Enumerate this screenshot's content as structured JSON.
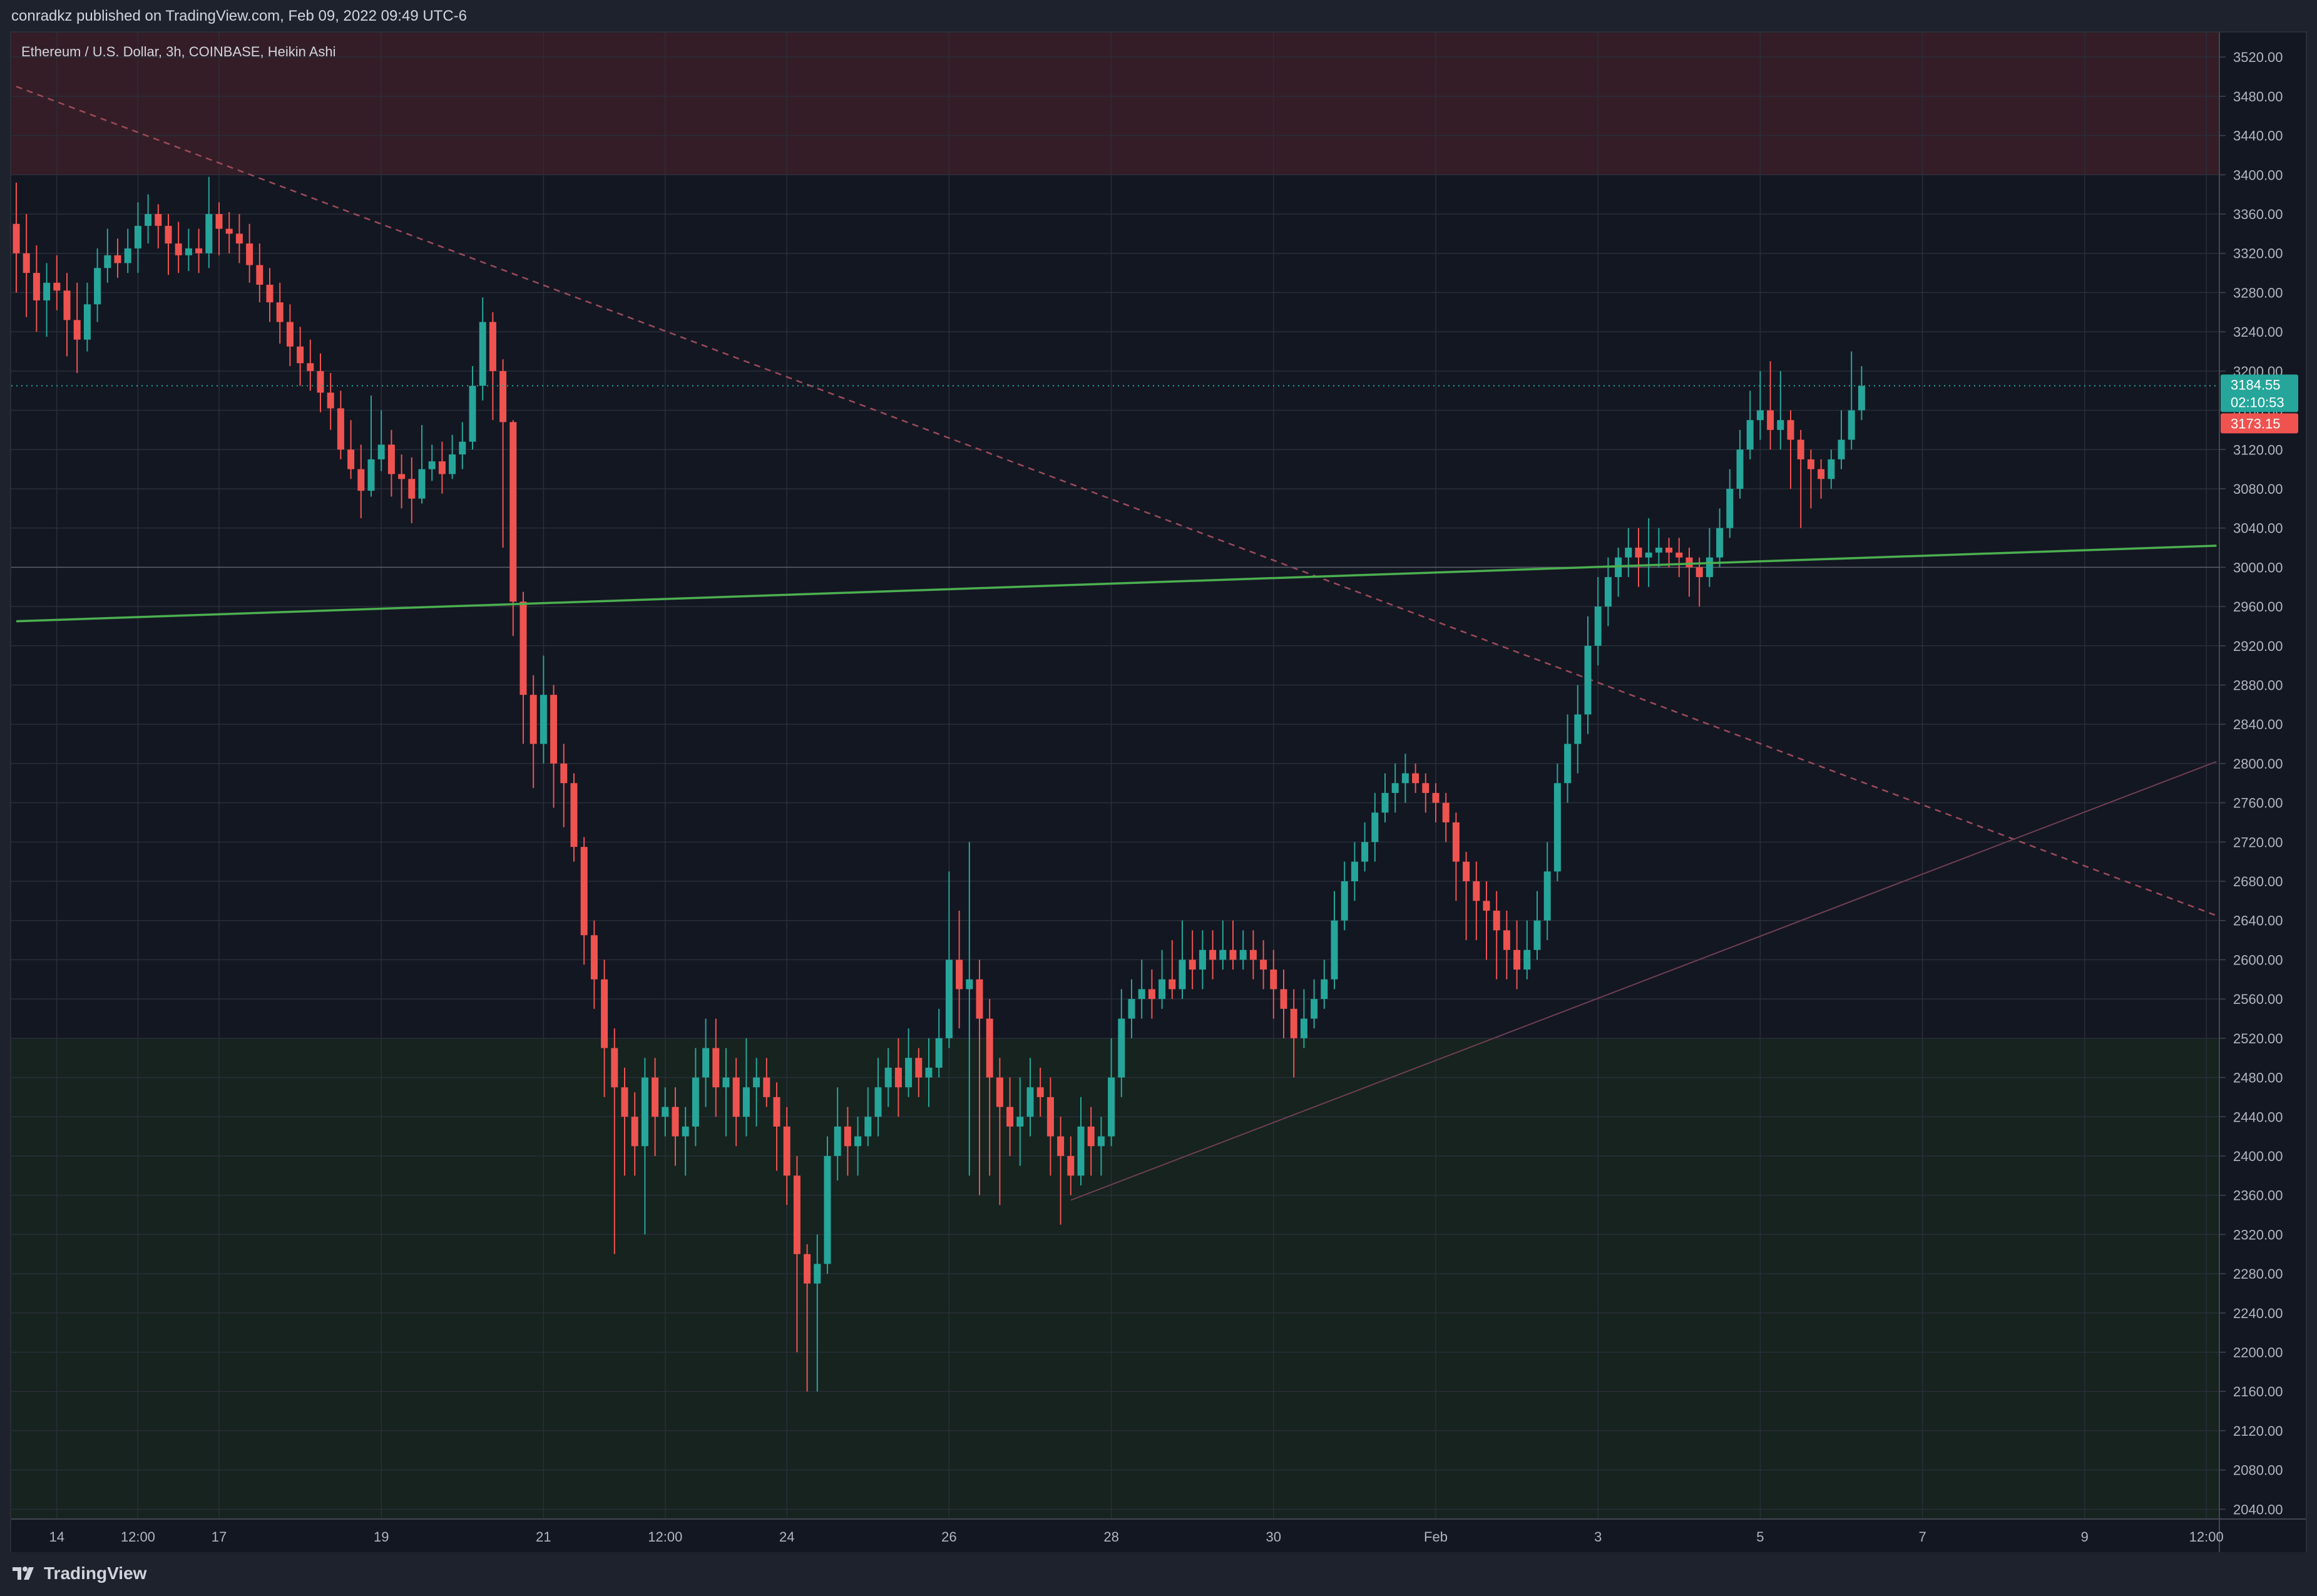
{
  "header": {
    "publisher_line": "conradkz published on TradingView.com, Feb 09, 2022 09:49 UTC-6"
  },
  "chart": {
    "symbol_line": "Ethereum / U.S. Dollar, 3h, COINBASE, Heikin Ashi",
    "last_price_label": "3184.55",
    "countdown_label": "02:10:53",
    "prev_close_label": "3173.15"
  },
  "footer": {
    "brand": "TradingView"
  },
  "colors": {
    "up": "#26a69a",
    "down": "#ef5350",
    "background": "#131722",
    "support_line": "#4caf50",
    "resistance_zone": "#3b1e27",
    "demand_zone": "#17261f"
  },
  "chart_data": {
    "type": "candlestick",
    "style": "heikin-ashi",
    "timeframe": "3h",
    "ylim": [
      2030,
      3545
    ],
    "y_ticks": [
      2040,
      2080,
      2120,
      2160,
      2200,
      2240,
      2280,
      2320,
      2360,
      2400,
      2440,
      2480,
      2520,
      2560,
      2600,
      2640,
      2680,
      2720,
      2760,
      2800,
      2840,
      2880,
      2920,
      2960,
      3000,
      3040,
      3080,
      3120,
      3160,
      3200,
      3240,
      3280,
      3320,
      3360,
      3400,
      3440,
      3480,
      3520
    ],
    "x_tick_labels": [
      {
        "i": 4,
        "label": "14"
      },
      {
        "i": 12,
        "label": "12:00"
      },
      {
        "i": 20,
        "label": "17"
      },
      {
        "i": 36,
        "label": "19"
      },
      {
        "i": 52,
        "label": "21"
      },
      {
        "i": 64,
        "label": "12:00"
      },
      {
        "i": 76,
        "label": "24"
      },
      {
        "i": 92,
        "label": "26"
      },
      {
        "i": 108,
        "label": "28"
      },
      {
        "i": 124,
        "label": "30"
      },
      {
        "i": 140,
        "label": "Feb"
      },
      {
        "i": 156,
        "label": "3"
      },
      {
        "i": 172,
        "label": "5"
      },
      {
        "i": 188,
        "label": "7"
      },
      {
        "i": 204,
        "label": "9"
      },
      {
        "i": 216,
        "label": "12:00"
      }
    ],
    "candles": [
      [
        3350,
        3320,
        3392,
        3280
      ],
      [
        3320,
        3300,
        3360,
        3255
      ],
      [
        3300,
        3272,
        3328,
        3240
      ],
      [
        3272,
        3290,
        3310,
        3235
      ],
      [
        3290,
        3282,
        3318,
        3262
      ],
      [
        3282,
        3252,
        3300,
        3215
      ],
      [
        3252,
        3232,
        3290,
        3198
      ],
      [
        3232,
        3268,
        3290,
        3220
      ],
      [
        3268,
        3305,
        3325,
        3250
      ],
      [
        3305,
        3318,
        3345,
        3290
      ],
      [
        3318,
        3310,
        3335,
        3295
      ],
      [
        3310,
        3325,
        3345,
        3300
      ],
      [
        3325,
        3348,
        3372,
        3300
      ],
      [
        3348,
        3360,
        3380,
        3330
      ],
      [
        3360,
        3348,
        3370,
        3325
      ],
      [
        3348,
        3330,
        3360,
        3298
      ],
      [
        3330,
        3318,
        3352,
        3300
      ],
      [
        3318,
        3325,
        3345,
        3302
      ],
      [
        3325,
        3320,
        3345,
        3300
      ],
      [
        3320,
        3360,
        3398,
        3305
      ],
      [
        3360,
        3345,
        3372,
        3318
      ],
      [
        3345,
        3340,
        3362,
        3320
      ],
      [
        3340,
        3330,
        3360,
        3310
      ],
      [
        3330,
        3308,
        3350,
        3290
      ],
      [
        3308,
        3288,
        3330,
        3270
      ],
      [
        3288,
        3270,
        3305,
        3250
      ],
      [
        3270,
        3250,
        3290,
        3228
      ],
      [
        3250,
        3225,
        3268,
        3205
      ],
      [
        3225,
        3208,
        3245,
        3185
      ],
      [
        3208,
        3200,
        3232,
        3180
      ],
      [
        3200,
        3178,
        3218,
        3158
      ],
      [
        3178,
        3162,
        3198,
        3140
      ],
      [
        3162,
        3120,
        3180,
        3110
      ],
      [
        3120,
        3100,
        3150,
        3090
      ],
      [
        3100,
        3078,
        3125,
        3050
      ],
      [
        3078,
        3110,
        3175,
        3072
      ],
      [
        3110,
        3125,
        3160,
        3098
      ],
      [
        3125,
        3095,
        3140,
        3072
      ],
      [
        3095,
        3090,
        3115,
        3060
      ],
      [
        3090,
        3070,
        3112,
        3045
      ],
      [
        3070,
        3100,
        3145,
        3065
      ],
      [
        3100,
        3108,
        3125,
        3088
      ],
      [
        3108,
        3095,
        3128,
        3075
      ],
      [
        3095,
        3115,
        3135,
        3090
      ],
      [
        3115,
        3128,
        3148,
        3100
      ],
      [
        3128,
        3185,
        3205,
        3120
      ],
      [
        3185,
        3250,
        3275,
        3170
      ],
      [
        3250,
        3200,
        3260,
        3150
      ],
      [
        3200,
        3148,
        3212,
        3020
      ],
      [
        3148,
        2965,
        3150,
        2930
      ],
      [
        2965,
        2870,
        2975,
        2820
      ],
      [
        2870,
        2820,
        2890,
        2775
      ],
      [
        2820,
        2870,
        2910,
        2800
      ],
      [
        2870,
        2800,
        2880,
        2755
      ],
      [
        2800,
        2780,
        2820,
        2735
      ],
      [
        2780,
        2715,
        2790,
        2700
      ],
      [
        2715,
        2625,
        2725,
        2595
      ],
      [
        2625,
        2580,
        2640,
        2550
      ],
      [
        2580,
        2510,
        2600,
        2460
      ],
      [
        2510,
        2470,
        2530,
        2300
      ],
      [
        2470,
        2440,
        2490,
        2380
      ],
      [
        2440,
        2410,
        2465,
        2380
      ],
      [
        2410,
        2480,
        2500,
        2320
      ],
      [
        2480,
        2440,
        2500,
        2400
      ],
      [
        2440,
        2450,
        2470,
        2420
      ],
      [
        2450,
        2420,
        2470,
        2390
      ],
      [
        2420,
        2430,
        2450,
        2380
      ],
      [
        2430,
        2480,
        2510,
        2410
      ],
      [
        2480,
        2510,
        2540,
        2450
      ],
      [
        2510,
        2470,
        2540,
        2440
      ],
      [
        2470,
        2480,
        2510,
        2420
      ],
      [
        2480,
        2440,
        2500,
        2410
      ],
      [
        2440,
        2470,
        2520,
        2420
      ],
      [
        2470,
        2480,
        2500,
        2430
      ],
      [
        2480,
        2460,
        2500,
        2450
      ],
      [
        2460,
        2430,
        2475,
        2385
      ],
      [
        2430,
        2380,
        2450,
        2350
      ],
      [
        2380,
        2300,
        2400,
        2200
      ],
      [
        2300,
        2270,
        2310,
        2160
      ],
      [
        2270,
        2290,
        2320,
        2160
      ],
      [
        2290,
        2400,
        2420,
        2280
      ],
      [
        2400,
        2430,
        2470,
        2375
      ],
      [
        2430,
        2410,
        2450,
        2380
      ],
      [
        2410,
        2420,
        2440,
        2380
      ],
      [
        2420,
        2440,
        2470,
        2410
      ],
      [
        2440,
        2470,
        2500,
        2420
      ],
      [
        2470,
        2490,
        2510,
        2450
      ],
      [
        2490,
        2470,
        2520,
        2440
      ],
      [
        2470,
        2500,
        2530,
        2460
      ],
      [
        2500,
        2480,
        2510,
        2460
      ],
      [
        2480,
        2490,
        2520,
        2450
      ],
      [
        2490,
        2520,
        2550,
        2480
      ],
      [
        2520,
        2600,
        2690,
        2510
      ],
      [
        2600,
        2570,
        2650,
        2530
      ],
      [
        2570,
        2580,
        2720,
        2380
      ],
      [
        2580,
        2540,
        2600,
        2360
      ],
      [
        2540,
        2480,
        2560,
        2380
      ],
      [
        2480,
        2450,
        2500,
        2350
      ],
      [
        2450,
        2430,
        2480,
        2400
      ],
      [
        2430,
        2440,
        2480,
        2390
      ],
      [
        2440,
        2470,
        2500,
        2420
      ],
      [
        2470,
        2460,
        2490,
        2440
      ],
      [
        2460,
        2420,
        2480,
        2380
      ],
      [
        2420,
        2400,
        2440,
        2330
      ],
      [
        2400,
        2380,
        2420,
        2360
      ],
      [
        2380,
        2430,
        2460,
        2370
      ],
      [
        2430,
        2410,
        2450,
        2380
      ],
      [
        2410,
        2420,
        2440,
        2380
      ],
      [
        2420,
        2480,
        2520,
        2410
      ],
      [
        2480,
        2540,
        2570,
        2460
      ],
      [
        2540,
        2560,
        2580,
        2520
      ],
      [
        2560,
        2570,
        2600,
        2540
      ],
      [
        2570,
        2560,
        2590,
        2540
      ],
      [
        2560,
        2580,
        2610,
        2550
      ],
      [
        2580,
        2570,
        2620,
        2560
      ],
      [
        2570,
        2600,
        2640,
        2560
      ],
      [
        2600,
        2590,
        2630,
        2570
      ],
      [
        2590,
        2610,
        2630,
        2570
      ],
      [
        2610,
        2600,
        2630,
        2580
      ],
      [
        2600,
        2610,
        2640,
        2590
      ],
      [
        2610,
        2600,
        2640,
        2590
      ],
      [
        2600,
        2610,
        2630,
        2590
      ],
      [
        2610,
        2600,
        2630,
        2580
      ],
      [
        2600,
        2590,
        2620,
        2570
      ],
      [
        2590,
        2570,
        2610,
        2540
      ],
      [
        2570,
        2550,
        2590,
        2520
      ],
      [
        2550,
        2520,
        2570,
        2480
      ],
      [
        2520,
        2540,
        2570,
        2510
      ],
      [
        2540,
        2560,
        2580,
        2530
      ],
      [
        2560,
        2580,
        2600,
        2550
      ],
      [
        2580,
        2640,
        2670,
        2570
      ],
      [
        2640,
        2680,
        2700,
        2630
      ],
      [
        2680,
        2700,
        2720,
        2660
      ],
      [
        2700,
        2720,
        2740,
        2690
      ],
      [
        2720,
        2750,
        2770,
        2700
      ],
      [
        2750,
        2770,
        2790,
        2740
      ],
      [
        2770,
        2780,
        2800,
        2750
      ],
      [
        2780,
        2790,
        2810,
        2760
      ],
      [
        2790,
        2780,
        2800,
        2770
      ],
      [
        2780,
        2770,
        2790,
        2750
      ],
      [
        2770,
        2760,
        2780,
        2740
      ],
      [
        2760,
        2740,
        2770,
        2720
      ],
      [
        2740,
        2700,
        2750,
        2660
      ],
      [
        2700,
        2680,
        2710,
        2620
      ],
      [
        2680,
        2660,
        2700,
        2620
      ],
      [
        2660,
        2650,
        2680,
        2600
      ],
      [
        2650,
        2630,
        2670,
        2580
      ],
      [
        2630,
        2610,
        2650,
        2580
      ],
      [
        2610,
        2590,
        2640,
        2570
      ],
      [
        2590,
        2610,
        2640,
        2580
      ],
      [
        2610,
        2640,
        2670,
        2600
      ],
      [
        2640,
        2690,
        2720,
        2620
      ],
      [
        2690,
        2780,
        2800,
        2680
      ],
      [
        2780,
        2820,
        2850,
        2760
      ],
      [
        2820,
        2850,
        2880,
        2790
      ],
      [
        2850,
        2920,
        2950,
        2830
      ],
      [
        2920,
        2960,
        2990,
        2900
      ],
      [
        2960,
        2990,
        3010,
        2940
      ],
      [
        2990,
        3010,
        3020,
        2970
      ],
      [
        3010,
        3020,
        3040,
        2990
      ],
      [
        3020,
        3010,
        3040,
        2980
      ],
      [
        3010,
        3015,
        3050,
        2980
      ],
      [
        3015,
        3020,
        3040,
        3000
      ],
      [
        3020,
        3015,
        3030,
        3000
      ],
      [
        3015,
        3010,
        3030,
        2990
      ],
      [
        3010,
        3000,
        3020,
        2970
      ],
      [
        3000,
        2990,
        3010,
        2960
      ],
      [
        2990,
        3010,
        3040,
        2980
      ],
      [
        3010,
        3040,
        3060,
        3000
      ],
      [
        3040,
        3080,
        3100,
        3030
      ],
      [
        3080,
        3120,
        3140,
        3070
      ],
      [
        3120,
        3150,
        3180,
        3110
      ],
      [
        3150,
        3160,
        3200,
        3130
      ],
      [
        3160,
        3140,
        3210,
        3120
      ],
      [
        3140,
        3150,
        3200,
        3120
      ],
      [
        3150,
        3130,
        3160,
        3080
      ],
      [
        3130,
        3110,
        3140,
        3040
      ],
      [
        3110,
        3100,
        3120,
        3060
      ],
      [
        3100,
        3090,
        3110,
        3070
      ],
      [
        3090,
        3110,
        3120,
        3080
      ],
      [
        3110,
        3130,
        3160,
        3100
      ],
      [
        3130,
        3160,
        3220,
        3120
      ],
      [
        3160,
        3185,
        3205,
        3150
      ]
    ],
    "support_line": {
      "from": [
        0,
        2945
      ],
      "to": [
        217,
        3022
      ]
    },
    "resistance_trend": {
      "from": [
        0,
        3490
      ],
      "to": [
        217,
        2645
      ]
    },
    "rising_trend": {
      "from": [
        104,
        2355
      ],
      "to": [
        217,
        2802
      ]
    },
    "h_line": 3000,
    "zones": [
      {
        "y": [
          3400,
          3545
        ],
        "kind": "resistance"
      },
      {
        "y": [
          2030,
          2520
        ],
        "kind": "demand"
      }
    ]
  }
}
